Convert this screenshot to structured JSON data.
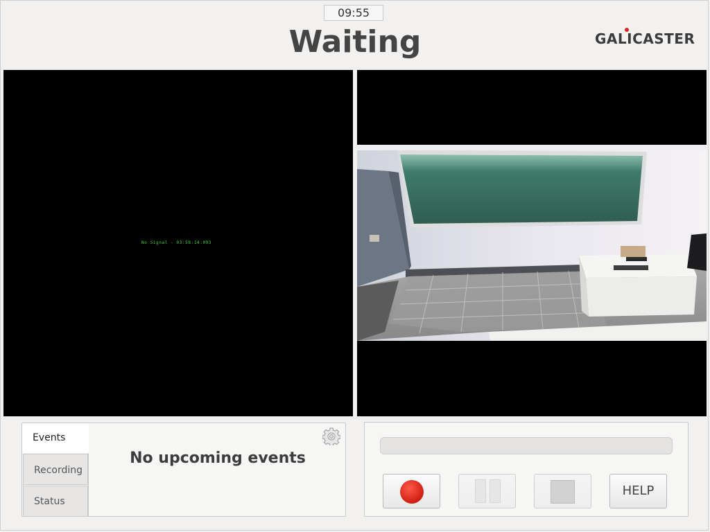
{
  "header": {
    "clock": "09:55",
    "status": "Waiting",
    "logo_text": "GALICASTER"
  },
  "previews": {
    "left_overlay": "No Signal - 03:58:14:093"
  },
  "events_panel": {
    "tabs": [
      {
        "label": "Events",
        "active": true
      },
      {
        "label": "Recording",
        "active": false
      },
      {
        "label": "Status",
        "active": false
      }
    ],
    "message": "No upcoming events"
  },
  "controls": {
    "progress": 0,
    "help_label": "HELP"
  },
  "colors": {
    "record": "#d01d12",
    "logo_dot": "#d7292b",
    "background": "#f2f1f0"
  }
}
